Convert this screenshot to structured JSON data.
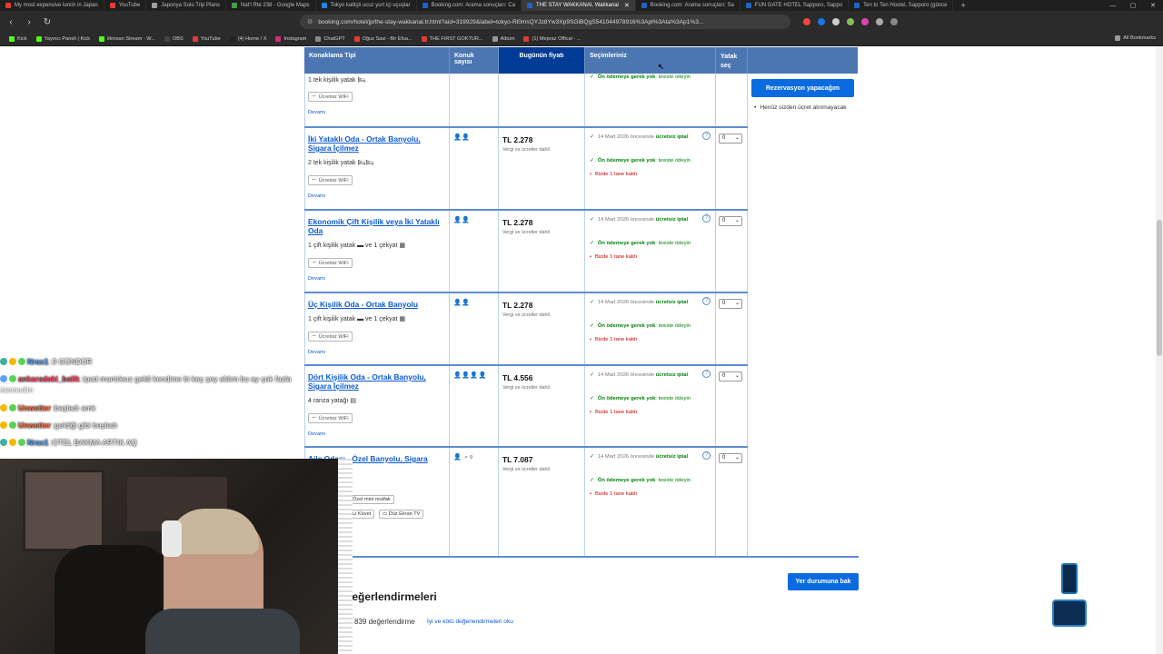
{
  "browser": {
    "tabs": [
      {
        "label": "My most expensive lunch in Japan",
        "color": "#e53935"
      },
      {
        "label": "YouTube",
        "color": "#e53935"
      },
      {
        "label": "Japonya Solo Trip Plans",
        "color": "#9e9e9e"
      },
      {
        "label": "Nat'l Rte 238 - Google Maps",
        "color": "#43a047"
      },
      {
        "label": "Tokyo kalitşli ucuz yurt içi uçuşlar",
        "color": "#1e88e5"
      },
      {
        "label": "Booking.com: Arama sonuçları: Ca",
        "color": "#1e64c8"
      },
      {
        "label": "THE STAY WAKKANAI, Wakkanai",
        "color": "#1e64c8",
        "active": true
      },
      {
        "label": "Booking.com: Arama sonuçları: Sa",
        "color": "#1e64c8"
      },
      {
        "label": "FUN GATE HOTEL Sapporo, Sappo",
        "color": "#1e64c8"
      },
      {
        "label": "Ten to Ten Hostel, Sapporo (günce",
        "color": "#1e64c8"
      }
    ],
    "url": "booking.com/hotel/jp/the-stay-wakkanai.tr.html?aid=319929&label=tokyo-Rl0msQYJz8Yw3Xp9SGlBQgS541044978916%3Apl%3Ata%3Ap1%3...",
    "bookmarks": [
      {
        "label": "Kick",
        "color": "#53fc18"
      },
      {
        "label": "Yayıncı Paneli | Kick",
        "color": "#53fc18"
      },
      {
        "label": "ilkinsan Stream - W...",
        "color": "#53fc18"
      },
      {
        "label": "OBS",
        "color": "#444"
      },
      {
        "label": "YouTube",
        "color": "#e53935"
      },
      {
        "label": "(4) Home / X",
        "color": "#222"
      },
      {
        "label": "Instagram",
        "color": "#d62976"
      },
      {
        "label": "ChatGPT",
        "color": "#888"
      },
      {
        "label": "Oğuz Sasi - Bir Efsa...",
        "color": "#e53935"
      },
      {
        "label": "THE FIRST GOKTUR...",
        "color": "#e53935"
      },
      {
        "label": "Albüm",
        "color": "#999"
      },
      {
        "label": "(1) Mepraz Offical - ...",
        "color": "#e53935"
      }
    ],
    "all_bookmarks": "All Bookmarks"
  },
  "table": {
    "headers": {
      "room_type": "Konaklama Tipi",
      "guests": "Konuk sayısı",
      "today_price": "Bugünün fiyatı",
      "choices": "Seçimleriniz",
      "select": "Yatak seç"
    },
    "rows": [
      {
        "name": "",
        "bed": "1 tek kişilik yatak",
        "bed_icon": "🛏",
        "wifi": "Ücretsiz WiFi",
        "more": "Devamı",
        "guests": "",
        "price": "",
        "tax": "",
        "cancel_date": "",
        "cancel_label": "",
        "no_prepay": "Ön ödemeye gerek yok",
        "pay_at": "tesiste ödeyin",
        "left": "",
        "qty": ""
      },
      {
        "name": "İki Yataklı Oda - Ortak Banyolu, Sigara İçilmez",
        "bed": "2 tek kişilik yatak",
        "bed_icon": "🛏🛏",
        "wifi": "Ücretsiz WiFi",
        "more": "Devamı",
        "guests": "👤👤",
        "price": "TL 2.278",
        "tax": "Vergi ve ücretler dahil",
        "cancel_date": "14 Mart 2026 öncesinde",
        "cancel_label": "ücretsiz iptal",
        "no_prepay": "Ön ödemeye gerek yok",
        "pay_at": "tesiste ödeyin",
        "left": "Bizde 1 tane kaldı",
        "qty": "0"
      },
      {
        "name": "Ekonomik Çift Kişilik veya İki Yataklı Oda",
        "bed": "1 çift kişilik yatak",
        "bed2": "ve 1 çekyat",
        "bed_icon": "",
        "wifi": "Ücretsiz WiFi",
        "more": "Devamı",
        "guests": "👤👤",
        "price": "TL 2.278",
        "tax": "Vergi ve ücretler dahil",
        "cancel_date": "14 Mart 2026 öncesinde",
        "cancel_label": "ücretsiz iptal",
        "no_prepay": "Ön ödemeye gerek yok",
        "pay_at": "tesiste ödeyin",
        "left": "Bizde 1 tane kaldı",
        "qty": "0"
      },
      {
        "name": "Üç Kişilik Oda - Ortak Banyolu",
        "bed": "1 çift kişilik yatak",
        "bed2": "ve 1 çekyat",
        "bed_icon": "",
        "wifi": "Ücretsiz WiFi",
        "more": "Devamı",
        "guests": "👤👤",
        "price": "TL 2.278",
        "tax": "Vergi ve ücretler dahil",
        "cancel_date": "14 Mart 2026 öncesinde",
        "cancel_label": "ücretsiz iptal",
        "no_prepay": "Ön ödemeye gerek yok",
        "pay_at": "tesiste ödeyin",
        "left": "Bizde 1 tane kaldı",
        "qty": "0"
      },
      {
        "name": "Dört Kişilik Oda - Ortak Banyolu, Sigara İçilmez",
        "bed": "4 ranza yatağı",
        "bed_icon": "",
        "wifi": "Ücretsiz WiFi",
        "more": "Devamı",
        "guests": "👤👤👤👤",
        "price": "TL 4.556",
        "tax": "Vergi ve ücretler dahil",
        "cancel_date": "14 Mart 2026 öncesinde",
        "cancel_label": "ücretsiz iptal",
        "no_prepay": "Ön ödemeye gerek yok",
        "pay_at": "tesiste ödeyin",
        "left": "Bizde 1 tane kaldı",
        "qty": "0"
      },
      {
        "name": "Aile Odası - Özel Banyolu, Sigara",
        "guests": "👤",
        "guests_mult": "× 9",
        "price": "TL 7.087",
        "tax": "Vergi ve ücretler dahil",
        "cancel_date": "14 Mart 2026 öncesinde",
        "cancel_label": "ücretsiz iptal",
        "no_prepay": "Ön ödemeye gerek yok",
        "pay_at": "tesiste ödeyin",
        "left": "Bizde 1 tane kaldı",
        "qty": "0",
        "amenities": [
          "Özel mini mutfak",
          "Küvet",
          "Düz Ekran TV"
        ]
      }
    ]
  },
  "sidebar": {
    "reserve_button": "Rezervasyon yapacağım",
    "note": "Henüz sizden ücret alınmayacak"
  },
  "bottom": {
    "status_button": "Yer durumuna bak",
    "reviews_title": "değerlendirmeleri",
    "reviews_count": "839 değerlendirme",
    "reviews_link": "İyi ve kötü değerlendirmeleri oku"
  },
  "chat": [
    {
      "nick": "Nrax1",
      "nick_color": "#5aa2ff",
      "msg": "3 GÜNDÜR"
    },
    {
      "nick": "ankaradaki_balik",
      "nick_color": "#ff4b6e",
      "msg": "ipad mantıksız geldi kendime bi kaç şey aldım bu ay çok fazla"
    },
    {
      "nick": "",
      "nick_color": "#fff",
      "msg": "istemedim"
    },
    {
      "nick": "Unwetter",
      "nick_color": "#ff7043",
      "msg": "başladı amk"
    },
    {
      "nick": "Unwetter",
      "nick_color": "#ff7043",
      "msg": "geldiği gibi başladı"
    },
    {
      "nick": "Nrax1",
      "nick_color": "#5aa2ff",
      "msg": "OTEL BAKMA ARTIK AQ"
    }
  ]
}
